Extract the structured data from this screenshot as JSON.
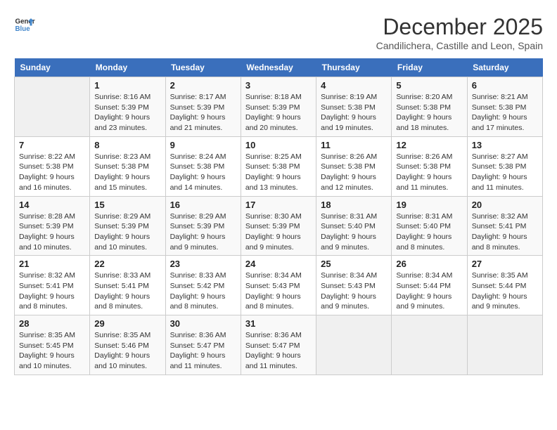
{
  "logo": {
    "line1": "General",
    "line2": "Blue"
  },
  "title": "December 2025",
  "subtitle": "Candilichera, Castille and Leon, Spain",
  "weekdays": [
    "Sunday",
    "Monday",
    "Tuesday",
    "Wednesday",
    "Thursday",
    "Friday",
    "Saturday"
  ],
  "weeks": [
    [
      {
        "day": "",
        "info": ""
      },
      {
        "day": "1",
        "info": "Sunrise: 8:16 AM\nSunset: 5:39 PM\nDaylight: 9 hours\nand 23 minutes."
      },
      {
        "day": "2",
        "info": "Sunrise: 8:17 AM\nSunset: 5:39 PM\nDaylight: 9 hours\nand 21 minutes."
      },
      {
        "day": "3",
        "info": "Sunrise: 8:18 AM\nSunset: 5:39 PM\nDaylight: 9 hours\nand 20 minutes."
      },
      {
        "day": "4",
        "info": "Sunrise: 8:19 AM\nSunset: 5:38 PM\nDaylight: 9 hours\nand 19 minutes."
      },
      {
        "day": "5",
        "info": "Sunrise: 8:20 AM\nSunset: 5:38 PM\nDaylight: 9 hours\nand 18 minutes."
      },
      {
        "day": "6",
        "info": "Sunrise: 8:21 AM\nSunset: 5:38 PM\nDaylight: 9 hours\nand 17 minutes."
      }
    ],
    [
      {
        "day": "7",
        "info": "Sunrise: 8:22 AM\nSunset: 5:38 PM\nDaylight: 9 hours\nand 16 minutes."
      },
      {
        "day": "8",
        "info": "Sunrise: 8:23 AM\nSunset: 5:38 PM\nDaylight: 9 hours\nand 15 minutes."
      },
      {
        "day": "9",
        "info": "Sunrise: 8:24 AM\nSunset: 5:38 PM\nDaylight: 9 hours\nand 14 minutes."
      },
      {
        "day": "10",
        "info": "Sunrise: 8:25 AM\nSunset: 5:38 PM\nDaylight: 9 hours\nand 13 minutes."
      },
      {
        "day": "11",
        "info": "Sunrise: 8:26 AM\nSunset: 5:38 PM\nDaylight: 9 hours\nand 12 minutes."
      },
      {
        "day": "12",
        "info": "Sunrise: 8:26 AM\nSunset: 5:38 PM\nDaylight: 9 hours\nand 11 minutes."
      },
      {
        "day": "13",
        "info": "Sunrise: 8:27 AM\nSunset: 5:38 PM\nDaylight: 9 hours\nand 11 minutes."
      }
    ],
    [
      {
        "day": "14",
        "info": "Sunrise: 8:28 AM\nSunset: 5:39 PM\nDaylight: 9 hours\nand 10 minutes."
      },
      {
        "day": "15",
        "info": "Sunrise: 8:29 AM\nSunset: 5:39 PM\nDaylight: 9 hours\nand 10 minutes."
      },
      {
        "day": "16",
        "info": "Sunrise: 8:29 AM\nSunset: 5:39 PM\nDaylight: 9 hours\nand 9 minutes."
      },
      {
        "day": "17",
        "info": "Sunrise: 8:30 AM\nSunset: 5:39 PM\nDaylight: 9 hours\nand 9 minutes."
      },
      {
        "day": "18",
        "info": "Sunrise: 8:31 AM\nSunset: 5:40 PM\nDaylight: 9 hours\nand 9 minutes."
      },
      {
        "day": "19",
        "info": "Sunrise: 8:31 AM\nSunset: 5:40 PM\nDaylight: 9 hours\nand 8 minutes."
      },
      {
        "day": "20",
        "info": "Sunrise: 8:32 AM\nSunset: 5:41 PM\nDaylight: 9 hours\nand 8 minutes."
      }
    ],
    [
      {
        "day": "21",
        "info": "Sunrise: 8:32 AM\nSunset: 5:41 PM\nDaylight: 9 hours\nand 8 minutes."
      },
      {
        "day": "22",
        "info": "Sunrise: 8:33 AM\nSunset: 5:41 PM\nDaylight: 9 hours\nand 8 minutes."
      },
      {
        "day": "23",
        "info": "Sunrise: 8:33 AM\nSunset: 5:42 PM\nDaylight: 9 hours\nand 8 minutes."
      },
      {
        "day": "24",
        "info": "Sunrise: 8:34 AM\nSunset: 5:43 PM\nDaylight: 9 hours\nand 8 minutes."
      },
      {
        "day": "25",
        "info": "Sunrise: 8:34 AM\nSunset: 5:43 PM\nDaylight: 9 hours\nand 9 minutes."
      },
      {
        "day": "26",
        "info": "Sunrise: 8:34 AM\nSunset: 5:44 PM\nDaylight: 9 hours\nand 9 minutes."
      },
      {
        "day": "27",
        "info": "Sunrise: 8:35 AM\nSunset: 5:44 PM\nDaylight: 9 hours\nand 9 minutes."
      }
    ],
    [
      {
        "day": "28",
        "info": "Sunrise: 8:35 AM\nSunset: 5:45 PM\nDaylight: 9 hours\nand 10 minutes."
      },
      {
        "day": "29",
        "info": "Sunrise: 8:35 AM\nSunset: 5:46 PM\nDaylight: 9 hours\nand 10 minutes."
      },
      {
        "day": "30",
        "info": "Sunrise: 8:36 AM\nSunset: 5:47 PM\nDaylight: 9 hours\nand 11 minutes."
      },
      {
        "day": "31",
        "info": "Sunrise: 8:36 AM\nSunset: 5:47 PM\nDaylight: 9 hours\nand 11 minutes."
      },
      {
        "day": "",
        "info": ""
      },
      {
        "day": "",
        "info": ""
      },
      {
        "day": "",
        "info": ""
      }
    ]
  ]
}
